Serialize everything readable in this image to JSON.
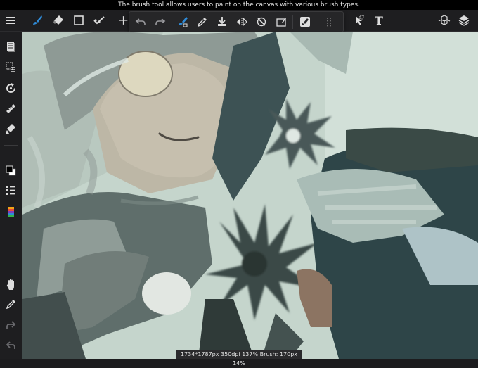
{
  "status_bar": {
    "tooltip": "The brush tool allows users to paint on the canvas with various brush types."
  },
  "toolbar": {
    "tools": [
      {
        "name": "menu-icon"
      },
      {
        "name": "brush-icon",
        "active": true
      },
      {
        "name": "eraser-icon"
      },
      {
        "name": "rectangle-icon"
      },
      {
        "name": "stroke-select-icon"
      },
      {
        "name": "transform-icon"
      },
      {
        "name": "selection-arrow-icon"
      },
      {
        "name": "text-icon",
        "glyph": "T"
      },
      {
        "name": "3d-cubes-icon"
      },
      {
        "name": "layers-icon"
      }
    ]
  },
  "floating_toolbar": {
    "buttons": [
      "undo-icon",
      "redo-icon",
      "brush-settings-icon",
      "eyedropper-icon",
      "download-fill-icon",
      "flip-horizontal-icon",
      "no-pressure-icon",
      "clear-icon",
      "brush-editor-icon",
      "drag-handle-icon"
    ]
  },
  "sidebar": {
    "items": [
      "documents-icon",
      "selection-list-icon",
      "rotate-reset-icon",
      "ruler-icon",
      "fill-bucket-icon",
      "color-swatch-icon",
      "stroke-list-icon",
      "color-palette-icon",
      "hand-icon",
      "eyedropper-icon",
      "redo-icon",
      "undo-icon"
    ]
  },
  "canvas_info": {
    "text": "1734*1787px 350dpi 137% Brush: 170px 14%"
  },
  "colors": {
    "accent": "#2f8bd8",
    "toolbar": "#1e1e20",
    "canvas_bg": "#c4d4cb"
  }
}
